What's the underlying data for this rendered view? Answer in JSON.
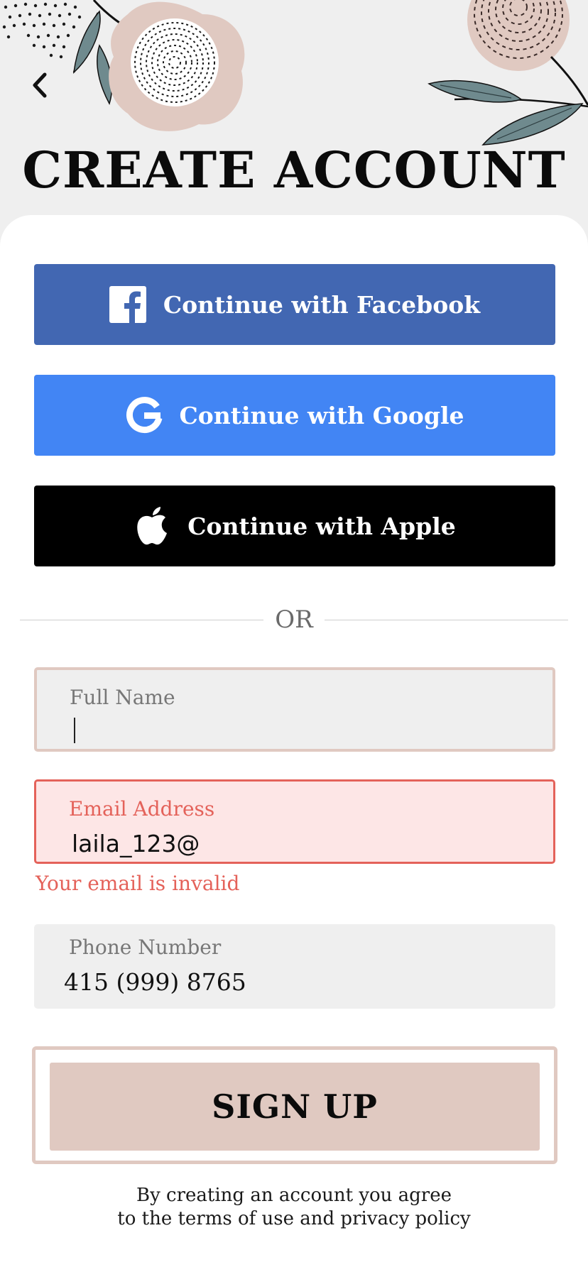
{
  "header": {
    "title": "CREATE ACCOUNT"
  },
  "social": {
    "facebook_label": "Continue with Facebook",
    "google_label": "Continue with Google",
    "apple_label": "Continue with Apple"
  },
  "divider": {
    "text": "OR"
  },
  "form": {
    "full_name": {
      "label": "Full Name",
      "value": ""
    },
    "email": {
      "label": "Email Address",
      "value": "laila_123@",
      "error": "Your email is invalid"
    },
    "phone": {
      "label": "Phone Number",
      "value": "415 (999) 8765"
    }
  },
  "signup": {
    "label": "SIGN UP"
  },
  "terms": {
    "line1": "By creating an account you agree",
    "line2": "to the terms of use and privacy policy"
  },
  "colors": {
    "facebook": "#4267b2",
    "google": "#4285f4",
    "apple": "#000000",
    "accent": "#e0c9c1",
    "error": "#e4625a",
    "leaf": "#6f8a8e"
  },
  "icons": {
    "back": "chevron-left-icon",
    "facebook": "facebook-icon",
    "google": "google-icon",
    "apple": "apple-icon"
  }
}
